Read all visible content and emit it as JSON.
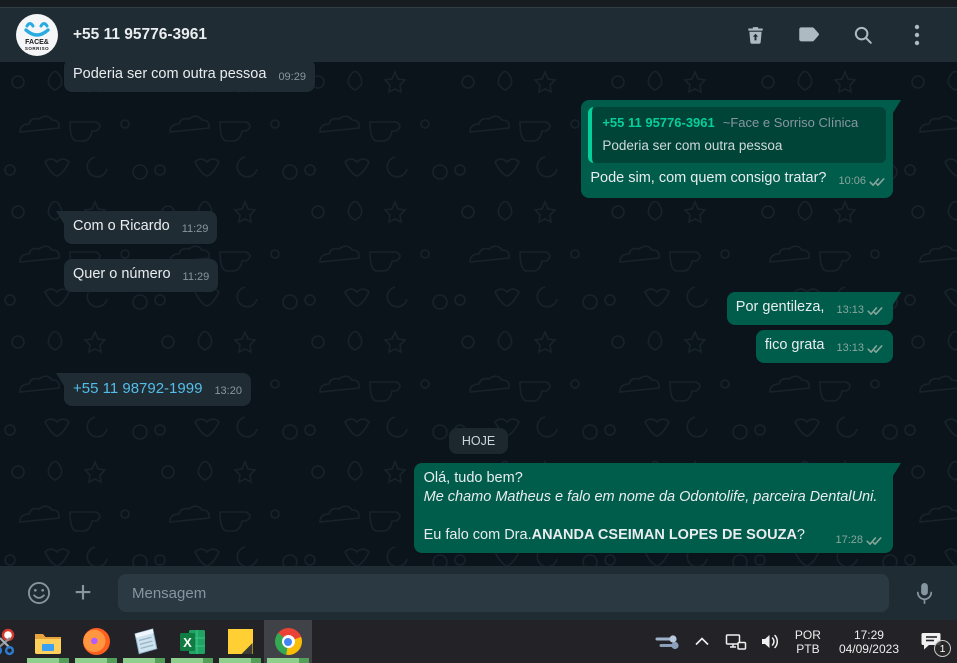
{
  "colors": {
    "header_bg": "#202c33",
    "chat_bg": "#0b141a",
    "incoming_bubble": "#202c33",
    "outgoing_bubble": "#005c4b",
    "quote_accent": "#06cf9c",
    "link_blue": "#53bdeb",
    "taskbar_bg": "#232227",
    "taskbar_underline_green": "#8ecf8d"
  },
  "header": {
    "title": "+55 11 95776-3961",
    "avatar_line1": "FACE&",
    "avatar_line2": "SORRISO",
    "icons": [
      "trash",
      "label",
      "search",
      "menu"
    ]
  },
  "chat": {
    "date_divider": "HOJE",
    "messages": [
      {
        "direction": "in",
        "text": "Poderia ser com outra pessoa",
        "time": "09:29"
      },
      {
        "direction": "out",
        "time": "10:06",
        "ticks": "double",
        "quote": {
          "number": "+55 11 95776-3961",
          "name": "~Face e Sorriso Clínica",
          "text": "Poderia ser com outra pessoa"
        },
        "text": "Pode sim, com quem consigo tratar?"
      },
      {
        "direction": "in",
        "text": "Com o Ricardo",
        "time": "11:29"
      },
      {
        "direction": "in",
        "text": "Quer o número",
        "time": "11:29"
      },
      {
        "direction": "out",
        "text": "Por gentileza,",
        "time": "13:13",
        "ticks": "double"
      },
      {
        "direction": "out",
        "text": "fico grata",
        "time": "13:13",
        "ticks": "double"
      },
      {
        "direction": "in",
        "text": "+55 11 98792-1999",
        "time": "13:20",
        "is_link": true
      },
      {
        "direction": "out",
        "time": "17:28",
        "ticks": "double",
        "line1": "Olá, tudo bem?",
        "line2": "Me chamo Matheus e falo em nome da Odontolife, parceira DentalUni.",
        "line4_prefix": "Eu falo com Dra.",
        "line4_bold": "ANANDA CSEIMAN LOPES DE SOUZA",
        "line4_suffix": "?"
      }
    ]
  },
  "composer": {
    "placeholder": "Mensagem"
  },
  "taskbar": {
    "apps": [
      "snipping-tool",
      "file-explorer",
      "firefox",
      "notepad",
      "excel",
      "sticky-notes",
      "chrome"
    ],
    "language_line1": "POR",
    "language_line2": "PTB",
    "time": "17:29",
    "date": "04/09/2023",
    "notification_count": "1"
  }
}
